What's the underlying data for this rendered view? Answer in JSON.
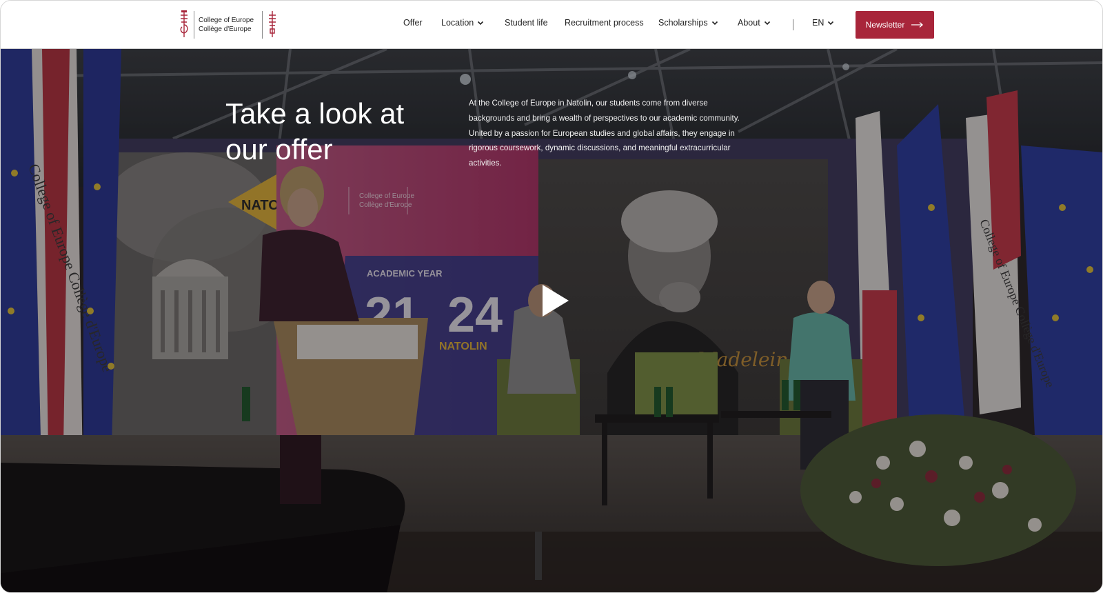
{
  "header": {
    "logo": {
      "name_en": "College of Europe",
      "name_fr": "Collège d'Europe"
    },
    "nav": [
      {
        "label": "Offer",
        "has_dropdown": false
      },
      {
        "label": "Location",
        "has_dropdown": true
      },
      {
        "label": "Student life",
        "has_dropdown": false
      },
      {
        "label": "Recruitment process",
        "has_dropdown": false
      },
      {
        "label": "Scholarships",
        "has_dropdown": true
      },
      {
        "label": "About",
        "has_dropdown": true
      }
    ],
    "language": "EN",
    "newsletter_label": "Newsletter"
  },
  "hero": {
    "title": "Take a look at our offer",
    "description": "At the College of Europe in Natolin, our students come from diverse backgrounds and bring a wealth of perspectives to our academic community. United by a passion for European studies and global affairs, they engage in rigorous coursework, dynamic discussions, and meaningful extracurricular activities.",
    "video": {
      "backdrop_text": {
        "academic_year": "ACADEMIC YEAR",
        "year_left": "21",
        "year_right": "24",
        "campus": "NATOLIN",
        "arrow_label": "NATOL",
        "portrait_caption": "Madeleine Albr",
        "flag_text": "College of Europe Collège d'Europe"
      }
    }
  },
  "colors": {
    "accent": "#a8253a",
    "header_bg": "#ffffff",
    "hero_text": "#ffffff"
  },
  "icons": {
    "play": "play-icon",
    "chevron": "chevron-down-icon",
    "arrow": "arrow-right-icon"
  }
}
